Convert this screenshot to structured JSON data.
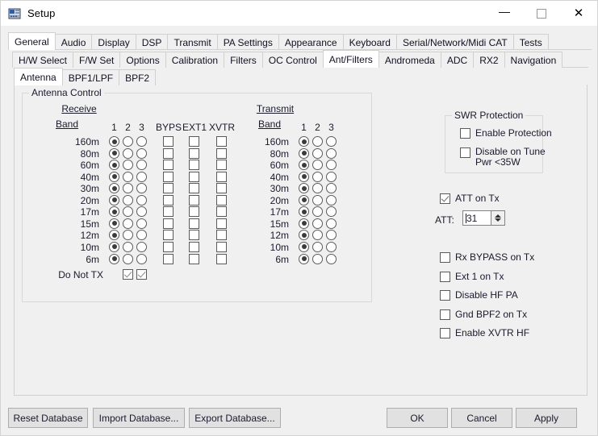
{
  "window": {
    "title": "Setup",
    "icon": "radio-transceiver-icon",
    "minimize": "—",
    "maximize": "□",
    "close": "✕"
  },
  "tabs_row1": {
    "items": [
      {
        "label": "General",
        "selected": true
      },
      {
        "label": "Audio",
        "selected": false
      },
      {
        "label": "Display",
        "selected": false
      },
      {
        "label": "DSP",
        "selected": false
      },
      {
        "label": "Transmit",
        "selected": false
      },
      {
        "label": "PA Settings",
        "selected": false
      },
      {
        "label": "Appearance",
        "selected": false
      },
      {
        "label": "Keyboard",
        "selected": false
      },
      {
        "label": "Serial/Network/Midi CAT",
        "selected": false
      },
      {
        "label": "Tests",
        "selected": false
      }
    ]
  },
  "tabs_row2": {
    "items": [
      {
        "label": "H/W Select",
        "selected": false
      },
      {
        "label": "F/W Set",
        "selected": false
      },
      {
        "label": "Options",
        "selected": false
      },
      {
        "label": "Calibration",
        "selected": false
      },
      {
        "label": "Filters",
        "selected": false
      },
      {
        "label": "OC Control",
        "selected": false
      },
      {
        "label": "Ant/Filters",
        "selected": true
      },
      {
        "label": "Andromeda",
        "selected": false
      },
      {
        "label": "ADC",
        "selected": false
      },
      {
        "label": "RX2",
        "selected": false
      },
      {
        "label": "Navigation",
        "selected": false
      }
    ]
  },
  "tabs_row3": {
    "items": [
      {
        "label": "Antenna",
        "selected": true
      },
      {
        "label": "BPF1/LPF",
        "selected": false
      },
      {
        "label": "BPF2",
        "selected": false
      }
    ]
  },
  "antenna_control": {
    "group_label": "Antenna Control",
    "receive": {
      "section_label": "Receive",
      "band_label": "Band",
      "ant_columns": [
        "1",
        "2",
        "3"
      ],
      "check_columns": [
        "BYPS",
        "EXT1",
        "XVTR"
      ],
      "rows": [
        {
          "band": "160m",
          "ant": 1,
          "byps": false,
          "ext1": false,
          "xvtr": false
        },
        {
          "band": "80m",
          "ant": 1,
          "byps": false,
          "ext1": false,
          "xvtr": false
        },
        {
          "band": "60m",
          "ant": 1,
          "byps": false,
          "ext1": false,
          "xvtr": false
        },
        {
          "band": "40m",
          "ant": 1,
          "byps": false,
          "ext1": false,
          "xvtr": false
        },
        {
          "band": "30m",
          "ant": 1,
          "byps": false,
          "ext1": false,
          "xvtr": false
        },
        {
          "band": "20m",
          "ant": 1,
          "byps": false,
          "ext1": false,
          "xvtr": false
        },
        {
          "band": "17m",
          "ant": 1,
          "byps": false,
          "ext1": false,
          "xvtr": false
        },
        {
          "band": "15m",
          "ant": 1,
          "byps": false,
          "ext1": false,
          "xvtr": false
        },
        {
          "band": "12m",
          "ant": 1,
          "byps": false,
          "ext1": false,
          "xvtr": false
        },
        {
          "band": "10m",
          "ant": 1,
          "byps": false,
          "ext1": false,
          "xvtr": false
        },
        {
          "band": "6m",
          "ant": 1,
          "byps": false,
          "ext1": false,
          "xvtr": false
        }
      ],
      "do_not_tx": {
        "label": "Do Not TX",
        "values": [
          false,
          true,
          true
        ]
      }
    },
    "transmit": {
      "section_label": "Transmit",
      "band_label": "Band",
      "ant_columns": [
        "1",
        "2",
        "3"
      ],
      "rows": [
        {
          "band": "160m",
          "ant": 1
        },
        {
          "band": "80m",
          "ant": 1
        },
        {
          "band": "60m",
          "ant": 1
        },
        {
          "band": "40m",
          "ant": 1
        },
        {
          "band": "30m",
          "ant": 1
        },
        {
          "band": "20m",
          "ant": 1
        },
        {
          "band": "17m",
          "ant": 1
        },
        {
          "band": "15m",
          "ant": 1
        },
        {
          "band": "12m",
          "ant": 1
        },
        {
          "band": "10m",
          "ant": 1
        },
        {
          "band": "6m",
          "ant": 1
        }
      ]
    }
  },
  "swr_protection": {
    "group_label": "SWR Protection",
    "enable_protection": {
      "label": "Enable Protection",
      "checked": false
    },
    "disable_on_tune": {
      "label_line1": "Disable on Tune",
      "label_line2": "Pwr <35W",
      "checked": false
    }
  },
  "att": {
    "on_tx": {
      "label": "ATT on Tx",
      "checked": true
    },
    "field_label": "ATT:",
    "value": "31",
    "spinner_up": "up-arrow-icon",
    "spinner_down": "down-arrow-icon"
  },
  "tx_options": [
    {
      "label": "Rx BYPASS on Tx",
      "checked": false
    },
    {
      "label": "Ext 1 on Tx",
      "checked": false
    },
    {
      "label": "Disable HF PA",
      "checked": false
    },
    {
      "label": "Gnd BPF2 on Tx",
      "checked": false
    },
    {
      "label": "Enable XVTR HF",
      "checked": false
    }
  ],
  "footer": {
    "reset_database": "Reset Database",
    "import_database": "Import Database...",
    "export_database": "Export Database...",
    "ok": "OK",
    "cancel": "Cancel",
    "apply": "Apply"
  },
  "colors": {
    "window_bg": "#f0f0f0",
    "titlebar_bg": "#ffffff",
    "tab_selected_bg": "#ffffff",
    "button_bg": "#e1e1e1",
    "border": "#d0d0d0",
    "text": "#1a1a2e"
  }
}
